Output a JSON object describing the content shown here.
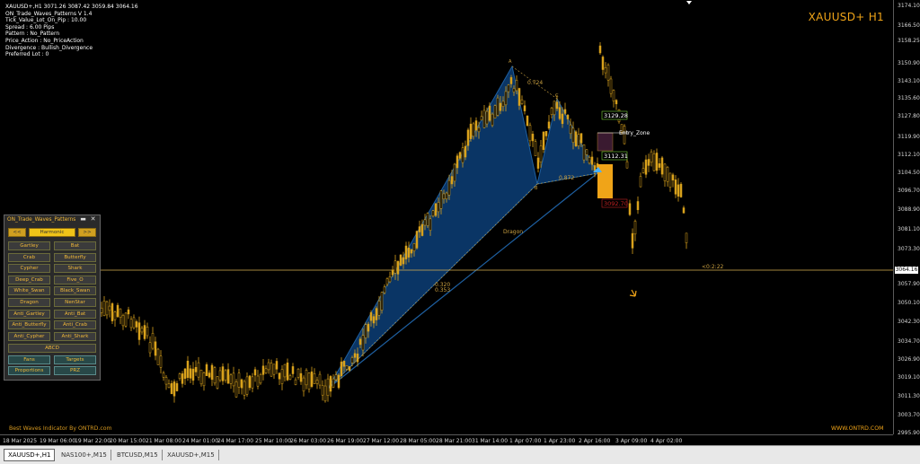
{
  "info": {
    "symbol_line": "XAUUSD+,H1   3071.26  3087.42  3059.84  3064.16",
    "lines": [
      "ON_Trade_Waves_Patterns V 1.4",
      "Tick_Value_Lot_On_Pip : 10.00",
      "Spread : 6.00  Pips",
      "Pattern : No_Pattern",
      "Price_Action : No_PriceAction",
      "Divergence : Bullish_Divergence",
      "Preferred Lot : 0"
    ]
  },
  "symbol_label": "XAUUSD+ H1",
  "price_ticks": [
    "3174.10",
    "3166.50",
    "3158.25",
    "3150.90",
    "3143.10",
    "3135.60",
    "3127.80",
    "3119.90",
    "3112.10",
    "3104.50",
    "3096.70",
    "3088.90",
    "3081.10",
    "3073.30",
    "3064.16",
    "3057.90",
    "3050.10",
    "3042.30",
    "3034.70",
    "3026.90",
    "3019.10",
    "3011.30",
    "3003.70",
    "2995.90"
  ],
  "current_price": "3064.16",
  "time_ticks": [
    "18 Mar 2025",
    "19 Mar 06:00",
    "19 Mar 22:00",
    "20 Mar 15:00",
    "21 Mar 08:00",
    "24 Mar 01:00",
    "24 Mar 17:00",
    "25 Mar 10:00",
    "26 Mar 03:00",
    "26 Mar 19:00",
    "27 Mar 12:00",
    "28 Mar 05:00",
    "28 Mar 21:00",
    "31 Mar 14:00",
    "1 Apr 07:00",
    "1 Apr 23:00",
    "2 Apr 16:00",
    "3 Apr 09:00",
    "4 Apr 02:00"
  ],
  "annotations": {
    "ratio_top": "0.724",
    "ratio_bd": "0.872",
    "ratio_lower_1": "0.320",
    "ratio_lower_2": "0.353",
    "pattern_name": "Dragon",
    "point_a": "A",
    "point_b": "B",
    "point_c": "C",
    "entry_zone": "Entry_Zone",
    "level_1": "3129.28",
    "level_2": "3112.31",
    "level_3": "3092.70",
    "price_line_label": "<0:2:22"
  },
  "panel": {
    "title": "ON_Trade_Waves_Patterns",
    "nav_prev": "<<",
    "nav_mode": "Harmonic",
    "nav_next": ">>",
    "buttons": [
      [
        "Gartley",
        "Bat"
      ],
      [
        "Crab",
        "Butterfly"
      ],
      [
        "Cypher",
        "Shark"
      ],
      [
        "Deep_Crab",
        "Five_O"
      ],
      [
        "White_Swan",
        "Black_Swan"
      ],
      [
        "Dragon",
        "NenStar"
      ],
      [
        "Anti_Gartley",
        "Anti_Bat"
      ],
      [
        "Anti_Butterfly",
        "Anti_Crab"
      ],
      [
        "Anti_Cypher",
        "Anti_Shark"
      ]
    ],
    "abcd": "ABCD",
    "bottom_buttons": [
      [
        "Fans",
        "Targets"
      ],
      [
        "Proportions",
        "PRZ"
      ]
    ]
  },
  "footer_left": "Best Waves Indicator By ONTRD.com",
  "footer_right": "WWW.ONTRD.COM",
  "tabs": [
    "XAUUSD+,H1",
    "NAS100+,M15",
    "BTCUSD,M15",
    "XAUUSD+,M15"
  ],
  "colors": {
    "accent": "#f0a418",
    "candle": "#d9a21c",
    "pattern_fill": "#0b3a6e",
    "background": "#000000"
  }
}
